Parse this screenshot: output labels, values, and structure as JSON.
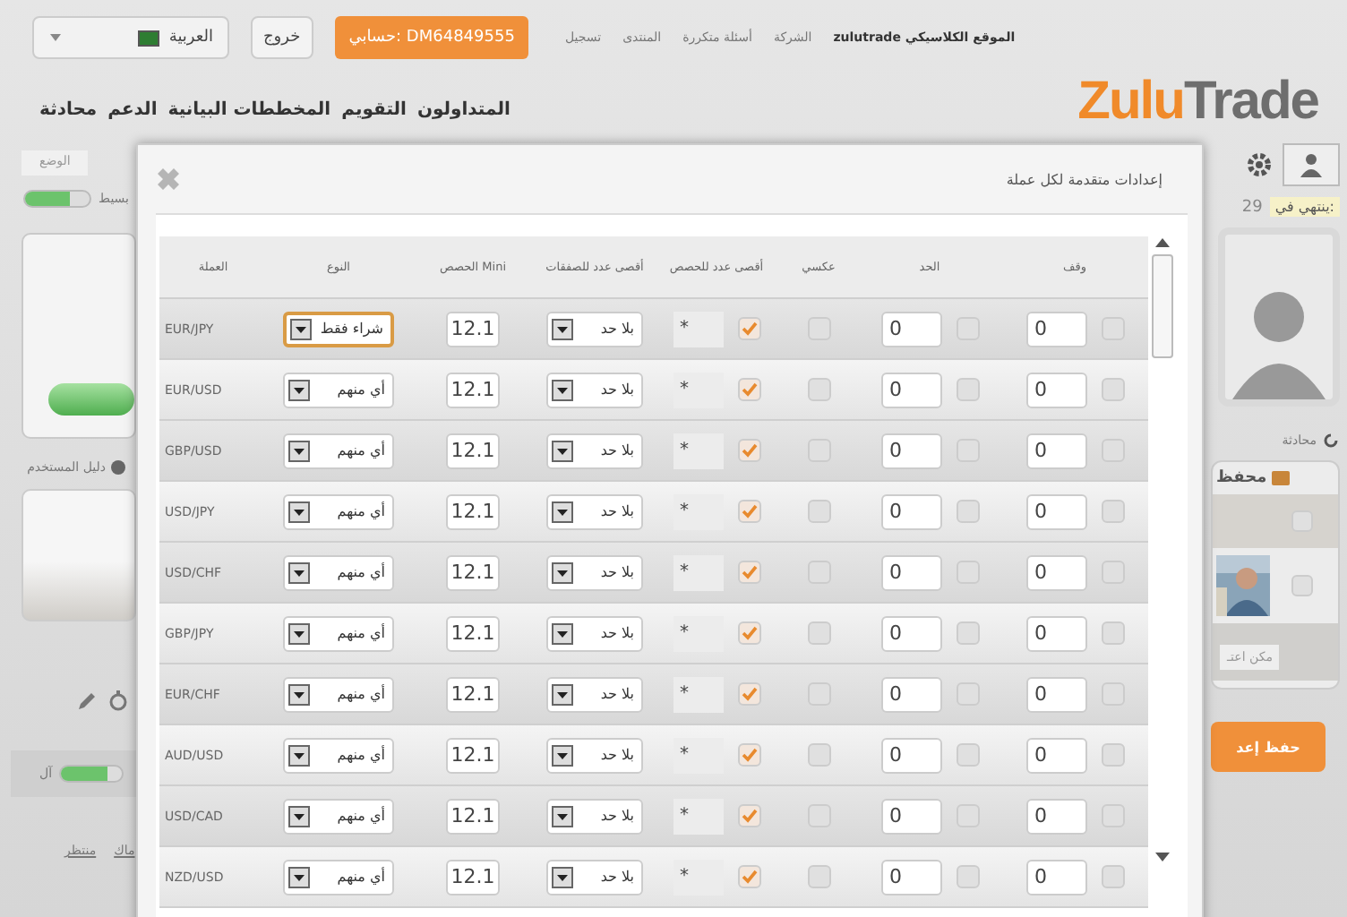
{
  "header": {
    "language": "العربية",
    "logout": "خروج",
    "account": "حسابي: DM64849555",
    "top_links": [
      "zulutrade الموقع الكلاسيكي",
      "الشركة",
      "أسئلة متكررة",
      "المنتدى",
      "تسجيل"
    ],
    "nav": [
      "المتداولون",
      "التقويم",
      "المخططات البيانية",
      "الدعم",
      "محادثة"
    ],
    "logo": {
      "first": "Zulu",
      "second": "Trade"
    }
  },
  "left_panel": {
    "tab": "الوضع",
    "slider": {
      "label": "بسيط",
      "level": 0.7
    },
    "guide": "دليل المستخدم",
    "slider2": {
      "label": "آل",
      "level": 0.75
    },
    "links": [
      "ماك",
      "منتظر"
    ]
  },
  "right_panel": {
    "expires_label": "ينتهي في:",
    "expires_value": "29",
    "chat": "محادثة",
    "portfolio": "محفظ",
    "portfolio_items": [
      {
        "checked": false
      },
      {
        "checked": false
      }
    ],
    "copy_field": "مكن اعتـ",
    "save_button": "حفظ إعد"
  },
  "dialog": {
    "title": "إعدادات متقدمة لكل عملة",
    "columns": [
      "وقف",
      "الحد",
      "عكسي",
      "أقصى عدد للحصص",
      "أقصى عدد للصفقات",
      "الحصص Mini",
      "النوع",
      "العملة"
    ],
    "rows": [
      {
        "currency": "EUR/JPY",
        "type": "شراء فقط",
        "type_focused": true,
        "mini": "12.1",
        "max_trades": "بلا حد",
        "max_lots": "*",
        "max_lots_checked": true,
        "reverse": false,
        "limit": "0",
        "limit_checked": false,
        "stop": "0",
        "stop_checked": false
      },
      {
        "currency": "EUR/USD",
        "type": "أي منهم",
        "type_focused": false,
        "mini": "12.1",
        "max_trades": "بلا حد",
        "max_lots": "*",
        "max_lots_checked": true,
        "reverse": false,
        "limit": "0",
        "limit_checked": false,
        "stop": "0",
        "stop_checked": false
      },
      {
        "currency": "GBP/USD",
        "type": "أي منهم",
        "type_focused": false,
        "mini": "12.1",
        "max_trades": "بلا حد",
        "max_lots": "*",
        "max_lots_checked": true,
        "reverse": false,
        "limit": "0",
        "limit_checked": false,
        "stop": "0",
        "stop_checked": false
      },
      {
        "currency": "USD/JPY",
        "type": "أي منهم",
        "type_focused": false,
        "mini": "12.1",
        "max_trades": "بلا حد",
        "max_lots": "*",
        "max_lots_checked": true,
        "reverse": false,
        "limit": "0",
        "limit_checked": false,
        "stop": "0",
        "stop_checked": false
      },
      {
        "currency": "USD/CHF",
        "type": "أي منهم",
        "type_focused": false,
        "mini": "12.1",
        "max_trades": "بلا حد",
        "max_lots": "*",
        "max_lots_checked": true,
        "reverse": false,
        "limit": "0",
        "limit_checked": false,
        "stop": "0",
        "stop_checked": false
      },
      {
        "currency": "GBP/JPY",
        "type": "أي منهم",
        "type_focused": false,
        "mini": "12.1",
        "max_trades": "بلا حد",
        "max_lots": "*",
        "max_lots_checked": true,
        "reverse": false,
        "limit": "0",
        "limit_checked": false,
        "stop": "0",
        "stop_checked": false
      },
      {
        "currency": "EUR/CHF",
        "type": "أي منهم",
        "type_focused": false,
        "mini": "12.1",
        "max_trades": "بلا حد",
        "max_lots": "*",
        "max_lots_checked": true,
        "reverse": false,
        "limit": "0",
        "limit_checked": false,
        "stop": "0",
        "stop_checked": false
      },
      {
        "currency": "AUD/USD",
        "type": "أي منهم",
        "type_focused": false,
        "mini": "12.1",
        "max_trades": "بلا حد",
        "max_lots": "*",
        "max_lots_checked": true,
        "reverse": false,
        "limit": "0",
        "limit_checked": false,
        "stop": "0",
        "stop_checked": false
      },
      {
        "currency": "USD/CAD",
        "type": "أي منهم",
        "type_focused": false,
        "mini": "12.1",
        "max_trades": "بلا حد",
        "max_lots": "*",
        "max_lots_checked": true,
        "reverse": false,
        "limit": "0",
        "limit_checked": false,
        "stop": "0",
        "stop_checked": false
      },
      {
        "currency": "NZD/USD",
        "type": "أي منهم",
        "type_focused": false,
        "mini": "12.1",
        "max_trades": "بلا حد",
        "max_lots": "*",
        "max_lots_checked": true,
        "reverse": false,
        "limit": "0",
        "limit_checked": false,
        "stop": "0",
        "stop_checked": false
      }
    ]
  }
}
